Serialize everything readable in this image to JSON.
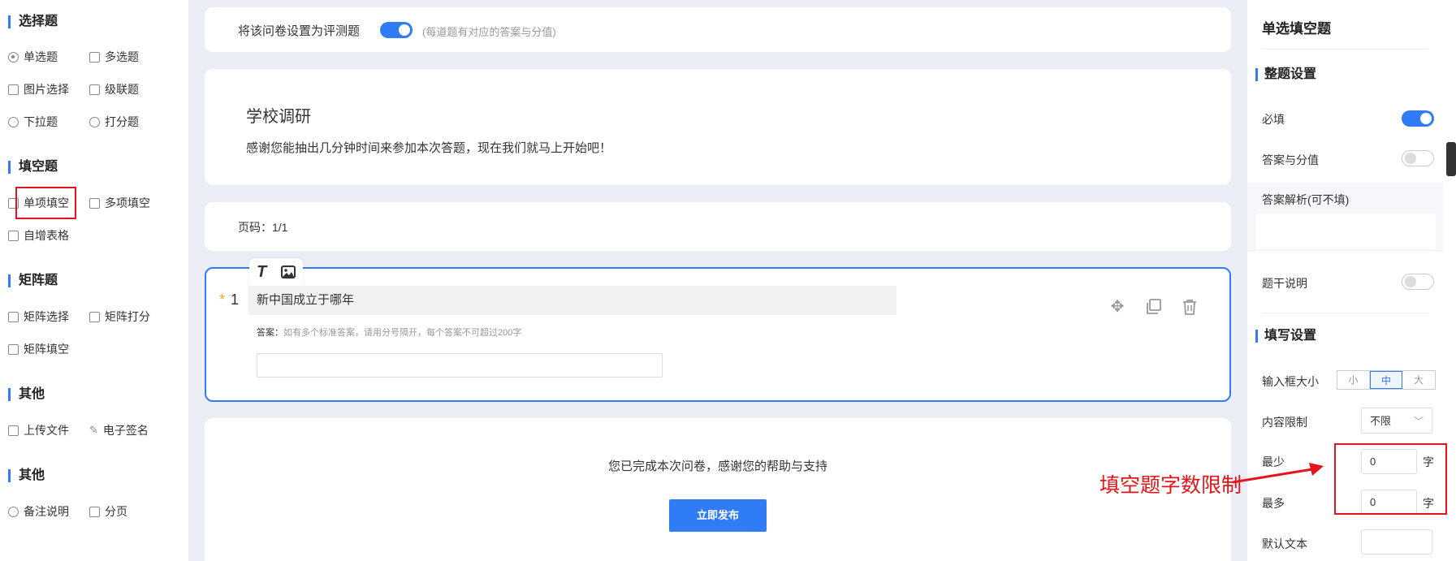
{
  "palette": {
    "sections": [
      {
        "title": "选择题"
      },
      {
        "title": "填空题"
      },
      {
        "title": "矩阵题"
      },
      {
        "title": "其他"
      },
      {
        "title": "其他"
      }
    ],
    "items": {
      "single_choice": "单选题",
      "multi_choice": "多选题",
      "image_choice": "图片选择",
      "cascade": "级联题",
      "dropdown": "下拉题",
      "rating": "打分题",
      "single_fill": "单项填空",
      "multi_fill": "多项填空",
      "auto_table": "自增表格",
      "matrix_choice": "矩阵选择",
      "matrix_rating": "矩阵打分",
      "matrix_fill": "矩阵填空",
      "upload_file": "上传文件",
      "e_signature": "电子签名",
      "remark": "备注说明",
      "pagination": "分页"
    }
  },
  "center": {
    "eval_toggle_label": "将该问卷设置为评测题",
    "eval_toggle_hint": "(每道题有对应的答案与分值)",
    "survey_title": "学校调研",
    "survey_desc": "感谢您能抽出几分钟时间来参加本次答题，现在我们就马上开始吧！",
    "page_label": "页码：1/1",
    "question": {
      "required_mark": "*",
      "number": "1",
      "title": "新中国成立于哪年",
      "answer_label": "答案：",
      "answer_hint": "如有多个标准答案，请用分号隔开，每个答案不可超过200字"
    },
    "finish_text": "您已完成本次问卷，感谢您的帮助与支持",
    "publish_button": "立即发布"
  },
  "right": {
    "panel_title": "单选填空题",
    "section_whole": "整题设置",
    "required_label": "必填",
    "answer_score_label": "答案与分值",
    "answer_analysis_label": "答案解析(可不填)",
    "stem_desc_label": "题干说明",
    "section_fill": "填写设置",
    "input_size_label": "输入框大小",
    "size_options": [
      "小",
      "中",
      "大"
    ],
    "content_limit_label": "内容限制",
    "content_limit_value": "不限",
    "min_label": "最少",
    "min_value": "0",
    "max_label": "最多",
    "max_value": "0",
    "char_unit": "字",
    "default_text_label": "默认文本"
  },
  "annotation": {
    "text": "填空题字数限制",
    "color": "#e5141a"
  },
  "colors": {
    "accent": "#2f7cf6",
    "required": "#f5a623"
  }
}
